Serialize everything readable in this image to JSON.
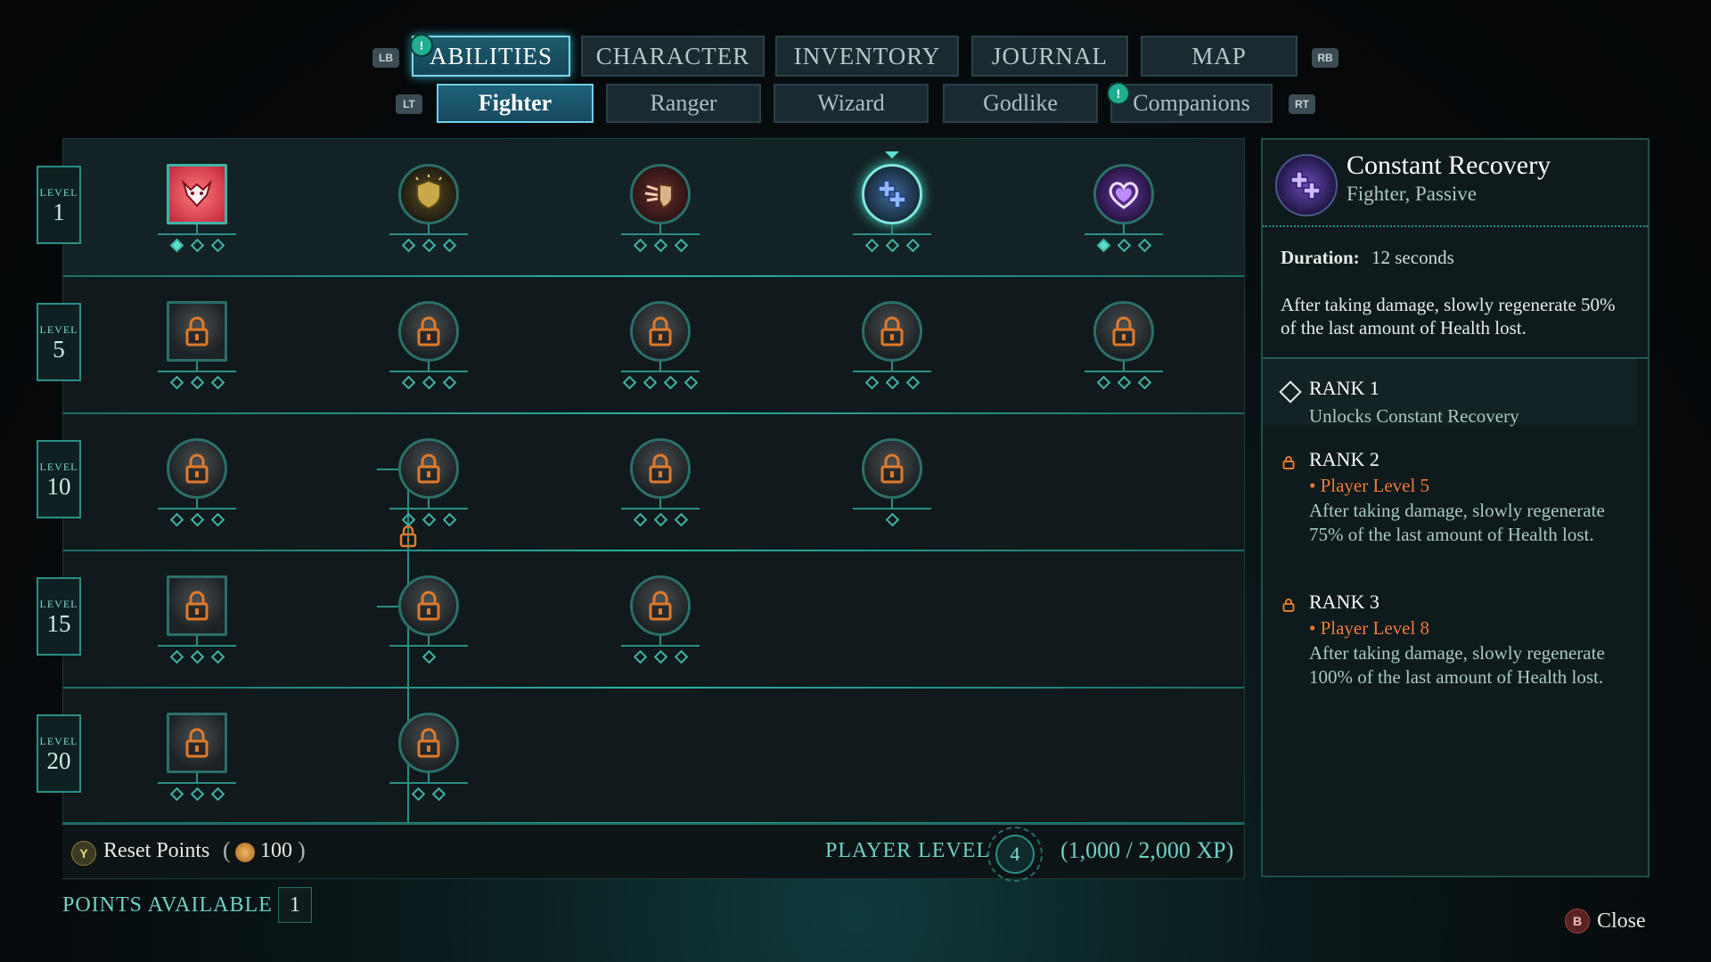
{
  "tabs": {
    "lb": "LB",
    "rb": "RB",
    "items": [
      "ABILITIES",
      "CHARACTER",
      "INVENTORY",
      "JOURNAL",
      "MAP"
    ],
    "alert": "!"
  },
  "subtabs": {
    "lt": "LT",
    "rt": "RT",
    "items": [
      "Fighter",
      "Ranger",
      "Wizard",
      "Godlike",
      "Companions"
    ],
    "alert": "!"
  },
  "levels": [
    "1",
    "5",
    "10",
    "15",
    "20"
  ],
  "level_word": "LEVEL",
  "bottom": {
    "y_button": "Y",
    "reset_label": "Reset Points",
    "reset_cost": "100",
    "player_level_label": "PLAYER LEVEL",
    "player_level": "4",
    "xp": "(1,000 / 2,000 XP)",
    "points_label": "POINTS AVAILABLE",
    "points": "1"
  },
  "detail": {
    "name": "Constant Recovery",
    "subtitle": "Fighter, Passive",
    "duration_label": "Duration:",
    "duration_value": "12 seconds",
    "description": "After taking damage, slowly regenerate 50% of the last amount of Health lost.",
    "rank1_title": "RANK 1",
    "rank1_text": "Unlocks Constant Recovery",
    "rank2_title": "RANK 2",
    "rank2_req": "• Player Level 5",
    "rank2_text": "After taking damage, slowly regenerate 75% of the last amount of Health lost.",
    "rank3_title": "RANK 3",
    "rank3_req": "• Player Level 8",
    "rank3_text": "After taking damage, slowly regenerate 100% of the last amount of Health lost."
  },
  "close": {
    "button": "B",
    "label": "Close"
  },
  "colors": {
    "accent": "#2bb3a3",
    "locked": "#e07a2a",
    "requirement": "#f07a3a",
    "active_tab": "#7fd6e6"
  }
}
